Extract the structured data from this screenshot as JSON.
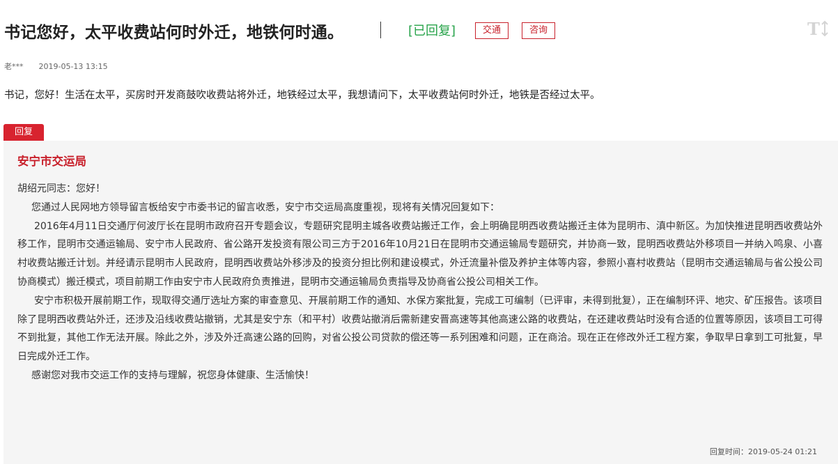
{
  "header": {
    "title": "书记您好，太平收费站何时外迁，地铁何时通。",
    "status": "[已回复]",
    "tags": [
      "交通",
      "咨询"
    ]
  },
  "meta": {
    "author": "老***",
    "date": "2019-05-13 13:15"
  },
  "message": "书记，您好！生活在太平，买房时开发商鼓吹收费站将外迁，地铁经过太平，我想请问下，太平收费站何时外迁，地铁是否经过太平。",
  "reply": {
    "label": "回复",
    "org": "安宁市交运局",
    "paragraphs": [
      "胡绍元同志：您好！",
      "您通过人民网地方领导留言板给安宁市委书记的留言收悉，安宁市交运局高度重视，现将有关情况回复如下：",
      "2016年4月11日交通厅何波厅长在昆明市政府召开专题会议，专题研究昆明主城各收费站搬迁工作，会上明确昆明西收费站搬迁主体为昆明市、滇中新区。为加快推进昆明西收费站外移工作，昆明市交通运输局、安宁市人民政府、省公路开发投资有限公司三方于2016年10月21日在昆明市交通运输局专题研究，并协商一致，昆明西收费站外移项目一并纳入鸣泉、小喜村收费站搬迁计划。并经请示昆明市人民政府，昆明西收费站外移涉及的投资分担比例和建设模式，外迁流量补偿及养护主体等内容，参照小喜村收费站（昆明市交通运输局与省公投公司协商模式）搬迁模式，项目前期工作由安宁市人民政府负责推进，昆明市交通运输局负责指导及协商省公投公司相关工作。",
      "安宁市积极开展前期工作，现取得交通厅选址方案的审查意见、开展前期工作的通知、水保方案批复，完成工可编制（已评审，未得到批复），正在编制环评、地灾、矿压报告。该项目除了昆明西收费站外迁，还涉及沿线收费站撤销，尤其是安宁东（和平村）收费站撤消后需新建安晋高速等其他高速公路的收费站，在还建收费站时没有合适的位置等原因，该项目工可得不到批复，其他工作无法开展。除此之外，涉及外迁高速公路的回购，对省公投公司贷款的偿还等一系列困难和问题，正在商洽。现在正在修改外迁工程方案，争取早日拿到工可批复，早日完成外迁工作。",
      "感谢您对我市交运工作的支持与理解，祝您身体健康、生活愉快！"
    ],
    "time_label": "回复时间：",
    "time": "2019-05-24 01:21"
  },
  "colors": {
    "accent_red": "#d8232f",
    "status_green": "#27a34a",
    "reply_bg": "#f5f5f5"
  },
  "icons": {
    "font_size_toggle": "font-size-toggle-icon"
  }
}
